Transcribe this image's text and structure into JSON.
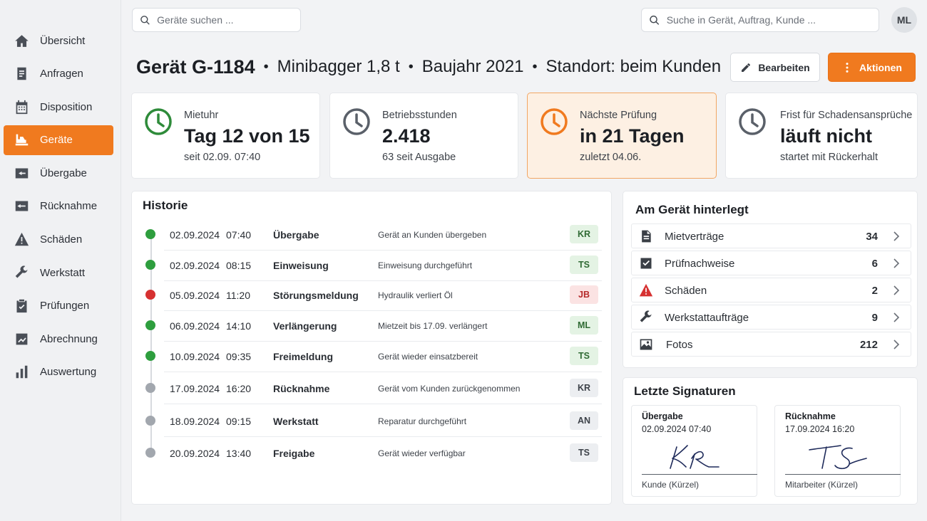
{
  "sidebar": {
    "items": [
      {
        "label": "Übersicht",
        "icon": "home-icon"
      },
      {
        "label": "Anfragen",
        "icon": "document-icon"
      },
      {
        "label": "Disposition",
        "icon": "calendar-icon"
      },
      {
        "label": "Geräte",
        "icon": "excavator-icon",
        "active": true
      },
      {
        "label": "Übergabe",
        "icon": "handover-icon"
      },
      {
        "label": "Rücknahme",
        "icon": "return-icon"
      },
      {
        "label": "Schäden",
        "icon": "warning-icon"
      },
      {
        "label": "Werkstatt",
        "icon": "wrench-icon"
      },
      {
        "label": "Prüfungen",
        "icon": "clipboard-check-icon"
      },
      {
        "label": "Abrechnung",
        "icon": "chart-line-icon"
      },
      {
        "label": "Auswertung",
        "icon": "bar-chart-icon"
      }
    ]
  },
  "topbar": {
    "device_search_placeholder": "Geräte suchen ...",
    "global_search_placeholder": "Suche in Gerät, Auftrag, Kunde ...",
    "avatar_initials": "ML"
  },
  "header": {
    "device_id": "Gerät G-1184",
    "model": "Minibagger 1,8 t",
    "year": "Baujahr 2021",
    "location": "Standort: beim Kunden",
    "separator": "•",
    "edit_label": "Bearbeiten",
    "actions_label": "Aktionen"
  },
  "stats": [
    {
      "label": "Mietuhr",
      "value": "Tag 12 von 15",
      "sub": "seit 02.09. 07:40",
      "icon_color": "#2e8b3a"
    },
    {
      "label": "Betriebsstunden",
      "value": "2.418",
      "sub": "63 seit Ausgabe",
      "icon_color": "#5a6069"
    },
    {
      "label": "Nächste Prüfung",
      "value": "in 21 Tagen",
      "sub": "zuletzt 04.06.",
      "icon_color": "#f07a1f"
    },
    {
      "label": "Frist für Schadensansprüche",
      "value": "läuft nicht",
      "sub": "startet mit Rückerhalt",
      "icon_color": "#5a6069"
    }
  ],
  "history": {
    "title": "Historie",
    "rows": [
      {
        "date": "02.09.2024",
        "time": "07:40",
        "event": "Übergabe",
        "desc": "Gerät an Kunden übergeben",
        "badge": "KR",
        "status": "green"
      },
      {
        "date": "02.09.2024",
        "time": "08:15",
        "event": "Einweisung",
        "desc": "Einweisung durchgeführt",
        "badge": "TS",
        "status": "green"
      },
      {
        "date": "05.09.2024",
        "time": "11:20",
        "event": "Störungsmeldung",
        "desc": "Hydraulik verliert Öl",
        "badge": "JB",
        "status": "red"
      },
      {
        "date": "06.09.2024",
        "time": "14:10",
        "event": "Verlängerung",
        "desc": "Mietzeit bis 17.09. verlängert",
        "badge": "ML",
        "status": "green"
      },
      {
        "date": "10.09.2024",
        "time": "09:35",
        "event": "Freimeldung",
        "desc": "Gerät wieder einsatzbereit",
        "badge": "TS",
        "status": "green"
      },
      {
        "date": "17.09.2024",
        "time": "16:20",
        "event": "Rücknahme",
        "desc": "Gerät vom Kunden zurückgenommen",
        "badge": "KR",
        "status": "gray"
      },
      {
        "date": "18.09.2024",
        "time": "09:15",
        "event": "Werkstatt",
        "desc": "Reparatur durchgeführt",
        "badge": "AN",
        "status": "gray"
      },
      {
        "date": "20.09.2024",
        "time": "13:40",
        "event": "Freigabe",
        "desc": "Gerät wieder verfügbar",
        "badge": "TS",
        "status": "gray"
      }
    ],
    "status_colors": {
      "green": "#2e9e3e",
      "red": "#d63131",
      "gray": "#a2a7ae"
    }
  },
  "linked": {
    "title": "Am Gerät hinterlegt",
    "rows": [
      {
        "label": "Mietverträge",
        "count": "34",
        "icon": "contract-icon"
      },
      {
        "label": "Prüfnachweise",
        "count": "6",
        "icon": "checkbox-icon"
      },
      {
        "label": "Schäden",
        "count": "2",
        "icon": "warning-icon"
      },
      {
        "label": "Werkstattaufträge",
        "count": "9",
        "icon": "wrench-icon"
      },
      {
        "label": "Fotos",
        "count": "212",
        "icon": "photo-icon"
      }
    ]
  },
  "signatures": {
    "title": "Letzte Signaturen",
    "cards": [
      {
        "title": "Übergabe",
        "date": "02.09.2024 07:40",
        "caption": "Kunde (Kürzel)",
        "signature_text": "KR"
      },
      {
        "title": "Rücknahme",
        "date": "17.09.2024 16:20",
        "caption": "Mitarbeiter (Kürzel)",
        "signature_text": "TS"
      }
    ]
  },
  "colors": {
    "accent": "#f07a1f",
    "warning_red": "#d63131",
    "success_green": "#2e9e3e"
  }
}
